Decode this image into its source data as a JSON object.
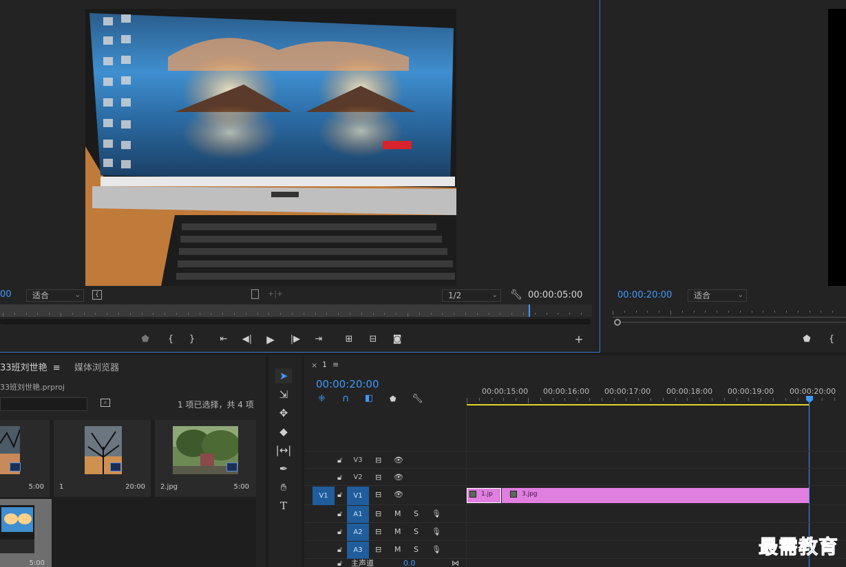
{
  "source": {
    "timecode_left": "00",
    "fit_label": "适合",
    "resolution": "1/2",
    "duration": "00:00:05:00"
  },
  "program": {
    "timecode": "00:00:20:00",
    "fit_label": "适合"
  },
  "project": {
    "tab_label": "33班刘世艳",
    "media_browser_label": "媒体浏览器",
    "file_name": "33班刘世艳.prproj",
    "selection_status": "1 项已选择，共 4 项",
    "items": [
      {
        "name": "",
        "duration": "5:00"
      },
      {
        "name": "1",
        "duration": "20:00"
      },
      {
        "name": "2.jpg",
        "duration": "5:00"
      },
      {
        "name": "",
        "duration": "5:00"
      }
    ]
  },
  "timeline": {
    "tab_label": "1",
    "timecode": "00:00:20:00",
    "ruler_labels": [
      "00:00:15:00",
      "00:00:16:00",
      "00:00:17:00",
      "00:00:18:00",
      "00:00:19:00",
      "00:00:20:00"
    ],
    "tracks": {
      "v3": "V3",
      "v2": "V2",
      "v1": "V1",
      "v1_target": "V1",
      "a1": "A1",
      "a2": "A2",
      "a3": "A3",
      "master_label": "主声道",
      "master_value": "0.0"
    },
    "mute": "M",
    "solo": "S",
    "clips": [
      {
        "label": "1.jp"
      },
      {
        "label": "3.jpg"
      }
    ]
  },
  "watermark": "最需教育",
  "colors": {
    "accent": "#3f9bff",
    "clip": "#e07fe0",
    "target": "#1f5d9c",
    "work_area": "#e6d32a"
  }
}
